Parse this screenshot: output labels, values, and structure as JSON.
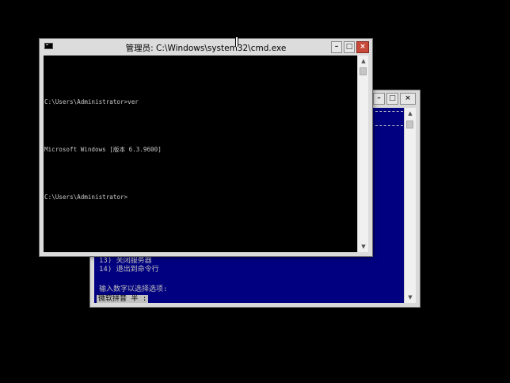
{
  "front_window": {
    "title": "管理员: C:\\Windows\\system32\\cmd.exe",
    "buttons": {
      "minimize": "–",
      "maximize": "□",
      "close": "×"
    },
    "console_lines": [
      "C:\\Users\\Administrator>ver",
      "Microsoft Windows [版本 6.3.9600]",
      "C:\\Users\\Administrator>"
    ]
  },
  "back_window": {
    "buttons": {
      "minimize": "–",
      "maximize": "□",
      "close": "×"
    },
    "menu_items": [
      {
        "text": "13) 关闭服务器"
      },
      {
        "text": "14) 退出到命令行"
      }
    ],
    "prompt": "输入数字以选择选项:",
    "input_line": "微软拼音 半 :"
  },
  "colors": {
    "front_console_bg": "#000000",
    "back_console_bg": "#000080",
    "close_button": "#c7493a",
    "desktop": "#000000"
  }
}
